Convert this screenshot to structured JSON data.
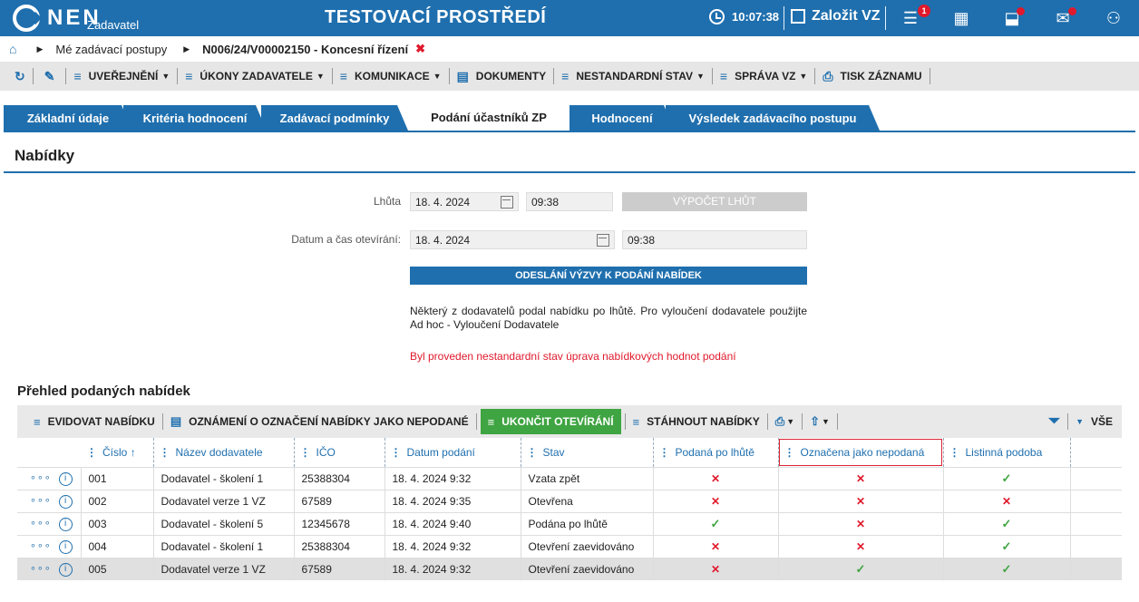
{
  "header": {
    "logo": "NEN",
    "logo_sub": "Zadavatel",
    "env_title": "TESTOVACÍ PROSTŘEDÍ",
    "clock": "10:07:38",
    "create_label": "Založit VZ",
    "menu_badge": "1",
    "colors": {
      "brand": "#1f6fae",
      "alert": "#e0192c"
    }
  },
  "breadcrumb": {
    "items": [
      "Mé zadávací postupy",
      "N006/24/V00002150 - Koncesní řízení"
    ]
  },
  "toolbar": {
    "items": [
      "UVEŘEJNĚNÍ",
      "ÚKONY ZADAVATELE",
      "KOMUNIKACE",
      "DOKUMENTY",
      "NESTANDARDNÍ STAV",
      "SPRÁVA VZ",
      "TISK ZÁZNAMU"
    ]
  },
  "tabs": [
    "Základní údaje",
    "Kritéria hodnocení",
    "Zadávací podmínky",
    "Podání účastníků ZP",
    "Hodnocení",
    "Výsledek zadávacího postupu"
  ],
  "section": {
    "title": "Nabídky",
    "lhuta_label": "Lhůta",
    "lhuta_date": "18. 4. 2024",
    "lhuta_time": "09:38",
    "calc_button": "VÝPOČET LHŮT",
    "opening_label": "Datum a čas otevírání:",
    "opening_date": "18. 4. 2024",
    "opening_time": "09:38",
    "send_button": "ODESLÁNÍ VÝZVY K PODÁNÍ NABÍDEK",
    "info_text": "Některý z dodavatelů podal nabídku po lhůtě. Pro vyloučení dodavatele použijte Ad hoc - Vyloučení Dodavatele",
    "warning_text": "Byl proveden nestandardní stav úprava nabídkových hodnot podání"
  },
  "offers": {
    "title": "Přehled podaných nabídek",
    "toolbar": {
      "register": "EVIDOVAT NABÍDKU",
      "notice": "OZNÁMENÍ O OZNAČENÍ NABÍDKY JAKO NEPODANÉ",
      "finish": "UKONČIT OTEVÍRÁNÍ",
      "download": "STÁHNOUT NABÍDKY",
      "all": "VŠE"
    },
    "columns": [
      "Číslo",
      "Název dodavatele",
      "IČO",
      "Datum podání",
      "Stav",
      "Podaná po lhůtě",
      "Označena jako nepodaná",
      "Listinná podoba"
    ],
    "rows": [
      {
        "num": "001",
        "name": "Dodavatel - školení 1",
        "ico": "25388304",
        "date": "18. 4. 2024 9:32",
        "state": "Vzata zpět",
        "late": "✕",
        "unsubmitted": "✕",
        "paper": "✓"
      },
      {
        "num": "002",
        "name": "Dodavatel verze 1 VZ",
        "ico": "67589",
        "date": "18. 4. 2024 9:35",
        "state": "Otevřena",
        "late": "✕",
        "unsubmitted": "✕",
        "paper": "✕"
      },
      {
        "num": "003",
        "name": "Dodavatel - školení 5",
        "ico": "12345678",
        "date": "18. 4. 2024 9:40",
        "state": "Podána po lhůtě",
        "late": "✓",
        "unsubmitted": "✕",
        "paper": "✓"
      },
      {
        "num": "004",
        "name": "Dodavatel - školení 1",
        "ico": "25388304",
        "date": "18. 4. 2024 9:32",
        "state": "Otevření zaevidováno",
        "late": "✕",
        "unsubmitted": "✕",
        "paper": "✓"
      },
      {
        "num": "005",
        "name": "Dodavatel verze 1 VZ",
        "ico": "67589",
        "date": "18. 4. 2024 9:32",
        "state": "Otevření zaevidováno",
        "late": "✕",
        "unsubmitted": "✓",
        "paper": "✓"
      }
    ]
  }
}
